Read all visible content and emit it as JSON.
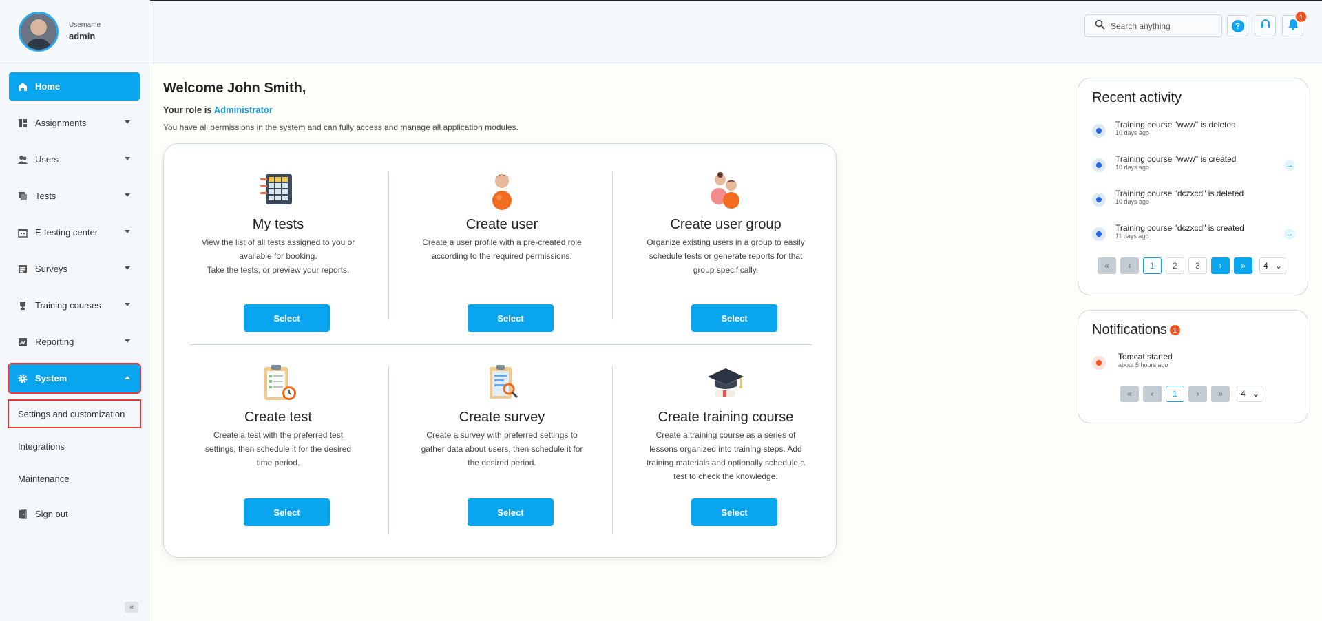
{
  "profile": {
    "label": "Username",
    "name": "admin"
  },
  "nav": {
    "home": "Home",
    "assignments": "Assignments",
    "users": "Users",
    "tests": "Tests",
    "etesting": "E-testing center",
    "surveys": "Surveys",
    "training": "Training courses",
    "reporting": "Reporting",
    "system": "System",
    "sub": {
      "settings": "Settings and customization",
      "integrations": "Integrations",
      "maintenance": "Maintenance"
    },
    "signout": "Sign out"
  },
  "header": {
    "search_placeholder": "Search anything",
    "help": "?",
    "notif_count": "1"
  },
  "main": {
    "welcome": "Welcome John Smith,",
    "role_prefix": "Your role is",
    "role_value": "Administrator",
    "permissions": "You have all permissions in the system and can fully access and manage all application modules.",
    "select_label": "Select",
    "cards": [
      {
        "title": "My tests",
        "desc": [
          "View the list of all tests assigned to you or",
          "available for booking.",
          "Take the tests, or preview your reports."
        ]
      },
      {
        "title": "Create user",
        "desc": [
          "Create a user profile with a pre-created role",
          "according to the required permissions."
        ]
      },
      {
        "title": "Create user group",
        "desc": [
          "Organize existing users in a group to easily",
          "schedule tests or generate reports for that",
          "group specifically."
        ]
      },
      {
        "title": "Create test",
        "desc": [
          "Create a test with the preferred test",
          "settings, then schedule it for the desired",
          "time period."
        ]
      },
      {
        "title": "Create survey",
        "desc": [
          "Create a survey with preferred settings to",
          "gather data about users, then schedule it for",
          "the desired period."
        ]
      },
      {
        "title": "Create training course",
        "desc": [
          "Create a training course as a series of",
          "lessons organized into training steps. Add",
          "training materials and optionally schedule a",
          "test to check the knowledge."
        ]
      }
    ]
  },
  "recent": {
    "title": "Recent activity",
    "items": [
      {
        "text": "Training course \"www\" is deleted",
        "time": "10 days ago"
      },
      {
        "text": "Training course \"www\" is created",
        "time": "10 days ago"
      },
      {
        "text": "Training course \"dczxcd\" is deleted",
        "time": "10 days ago"
      },
      {
        "text": "Training course \"dczxcd\" is created",
        "time": "11 days ago"
      }
    ],
    "pages": [
      "1",
      "2",
      "3"
    ],
    "page_size": "4"
  },
  "notifications": {
    "title": "Notifications",
    "count": "1",
    "items": [
      {
        "text": "Tomcat started",
        "time": "about 5 hours ago"
      }
    ],
    "pages": [
      "1"
    ],
    "page_size": "4"
  },
  "colors": {
    "accent": "#0aa5ef",
    "highlight": "#e53935",
    "badge": "#f4511e"
  }
}
